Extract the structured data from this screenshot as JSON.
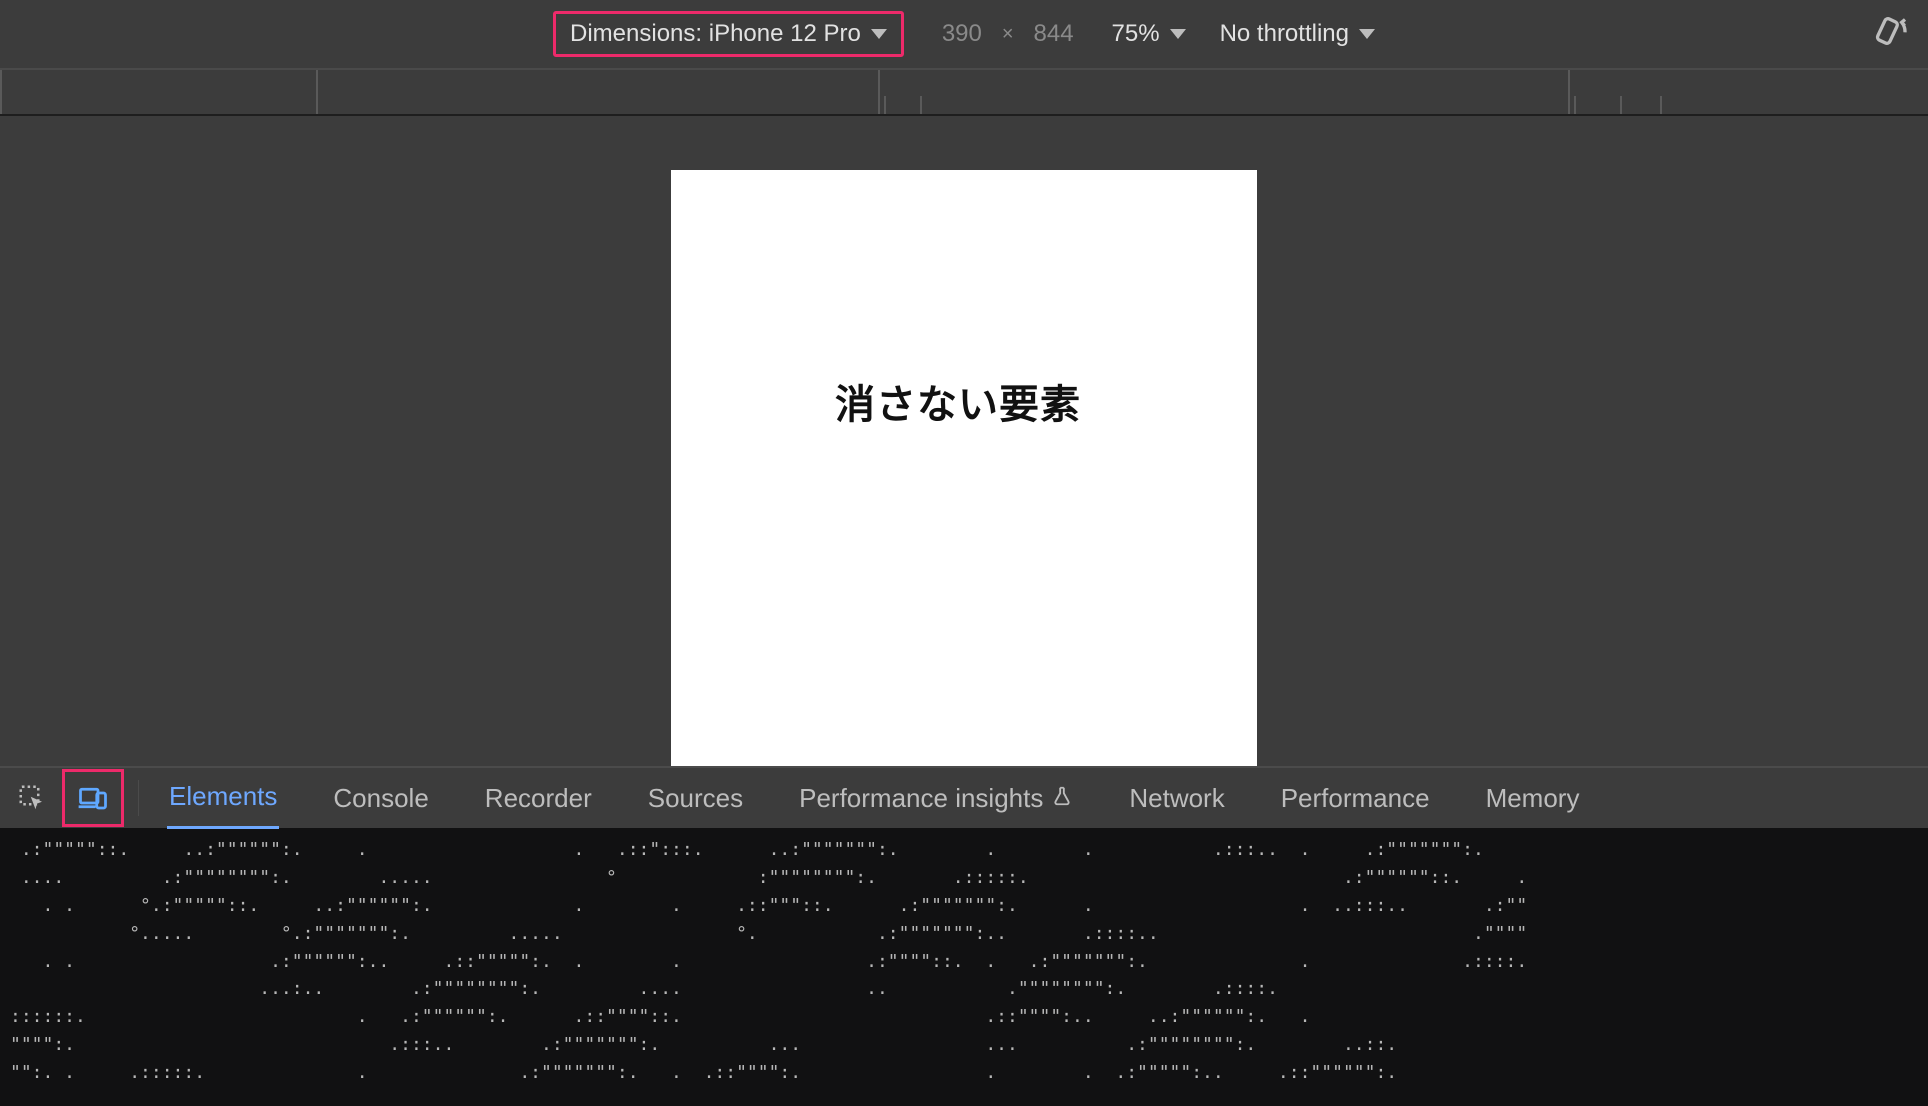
{
  "device_toolbar": {
    "dimensions_label": "Dimensions: iPhone 12 Pro",
    "width": "390",
    "height": "844",
    "separator": "×",
    "zoom": "75%",
    "throttling": "No throttling"
  },
  "page": {
    "heading": "消さない要素"
  },
  "devtools": {
    "tabs": [
      "Elements",
      "Console",
      "Recorder",
      "Sources",
      "Performance insights",
      "Network",
      "Performance",
      "Memory"
    ],
    "active_tab_index": 0
  },
  "ruler": {
    "major_positions": [
      0,
      316,
      878,
      1568
    ],
    "minor_positions": [
      884,
      920,
      1574,
      1620,
      1660
    ]
  }
}
